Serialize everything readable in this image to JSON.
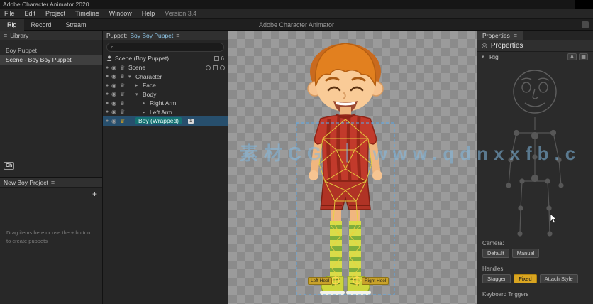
{
  "titlebar": {
    "title": "Adobe Character Animator 2020"
  },
  "menubar": {
    "items": [
      "File",
      "Edit",
      "Project",
      "Timeline",
      "Window",
      "Help"
    ],
    "version": "Version 3.4"
  },
  "workspace": {
    "tabs": [
      "Rig",
      "Record",
      "Stream"
    ],
    "center_title": "Adobe Character Animator"
  },
  "icons": {
    "menu": "≡",
    "plus": "+",
    "eye": "◉",
    "crown": "♛",
    "arrow_down": "▾",
    "arrow_right": "▸",
    "search": "⌕",
    "dot": "●",
    "target": "◎",
    "grid": "▦",
    "letter_a": "A"
  },
  "library_panel": {
    "header": "Library",
    "items": [
      "Boy Puppet",
      "Scene - Boy Boy Puppet"
    ],
    "badge": "Ch"
  },
  "project_panel": {
    "header": "New Boy Project",
    "hint1": "Drag items here or use the + button",
    "hint2": "to create puppets"
  },
  "puppet_panel": {
    "title_label": "Puppet:",
    "title_name": "Boy Boy Puppet",
    "scene_label": "Scene (Boy Puppet)",
    "scene_count": "6",
    "rows": [
      {
        "label": "Scene"
      },
      {
        "label": "Character"
      },
      {
        "label": "Face"
      },
      {
        "label": "Body"
      },
      {
        "label": "Right Arm"
      },
      {
        "label": "Left Arm"
      },
      {
        "label": "Boy (Wrapped)",
        "badge": "1"
      }
    ]
  },
  "canvas": {
    "watermark": "素材CG ｜ www.qdnxxfb.c",
    "tag_left": "Left Heel",
    "tag_right": "Right Heel"
  },
  "properties": {
    "tab": "Properties",
    "heading": "Properties",
    "section": "Rig",
    "camera_label": "Camera:",
    "camera_buttons": [
      "Default",
      "Manual"
    ],
    "handles_label": "Handles:",
    "handle_buttons": [
      "Stagger",
      "Fixed",
      "Attach Style"
    ],
    "footer": "Keyboard Triggers"
  }
}
